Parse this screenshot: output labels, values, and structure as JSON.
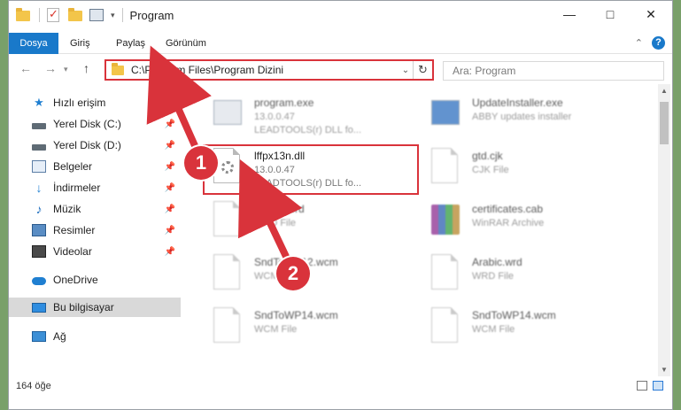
{
  "window": {
    "title": "Program",
    "icons": [
      "folder-icon",
      "check-icon",
      "properties-icon",
      "dropdown-icon"
    ]
  },
  "ribbon": {
    "tabs": [
      "Dosya",
      "Giriş",
      "Paylaş",
      "Görünüm"
    ],
    "accent_color": "#1979ca"
  },
  "address": {
    "path": "C:\\Program Files\\Program Dizini",
    "search_placeholder": "Ara: Program"
  },
  "nav": {
    "items": [
      {
        "label": "Hızlı erişim",
        "icon": "star-icon"
      },
      {
        "label": "Yerel Disk (C:)",
        "icon": "drive-icon",
        "pinned": true
      },
      {
        "label": "Yerel Disk (D:)",
        "icon": "drive-icon",
        "pinned": true
      },
      {
        "label": "Belgeler",
        "icon": "documents-icon",
        "pinned": true
      },
      {
        "label": "İndirmeler",
        "icon": "download-icon",
        "pinned": true
      },
      {
        "label": "Müzik",
        "icon": "music-icon",
        "pinned": true
      },
      {
        "label": "Resimler",
        "icon": "pictures-icon",
        "pinned": true
      },
      {
        "label": "Videolar",
        "icon": "videos-icon",
        "pinned": true
      },
      {
        "label": "OneDrive",
        "icon": "onedrive-icon"
      },
      {
        "label": "Bu bilgisayar",
        "icon": "computer-icon",
        "selected": true
      },
      {
        "label": "Ağ",
        "icon": "network-icon"
      }
    ]
  },
  "files": [
    {
      "name": "program.exe",
      "line2": "13.0.0.47",
      "line3": "LEADTOOLS(r) DLL fo...",
      "icon": "exe-icon",
      "blurred": true
    },
    {
      "name": "UpdateInstaller.exe",
      "line2": "ABBY updates installer",
      "line3": "",
      "icon": "installer-icon",
      "blurred": true
    },
    {
      "name": "lffpx13n.dll",
      "line2": "13.0.0.47",
      "line3": "LEADTOOLS(r) DLL fo...",
      "icon": "dll-icon",
      "blurred": false
    },
    {
      "name": "gtd.cjk",
      "line2": "CJK File",
      "line3": "",
      "icon": "file-icon",
      "blurred": true
    },
    {
      "name": "Arabic.wrd",
      "line2": "WRD File",
      "line3": "",
      "icon": "file-icon",
      "blurred": true
    },
    {
      "name": "certificates.cab",
      "line2": "WinRAR Archive",
      "line3": "",
      "icon": "rar-icon",
      "blurred": true
    },
    {
      "name": "SndToWP12.wcm",
      "line2": "WCM File",
      "line3": "",
      "icon": "file-icon",
      "blurred": true
    },
    {
      "name": "Arabic.wrd",
      "line2": "WRD File",
      "line3": "",
      "icon": "file-icon",
      "blurred": true
    },
    {
      "name": "SndToWP14.wcm",
      "line2": "WCM File",
      "line3": "",
      "icon": "file-icon",
      "blurred": true
    },
    {
      "name": "SndToWP14.wcm",
      "line2": "WCM File",
      "line3": "",
      "icon": "file-icon",
      "blurred": true
    }
  ],
  "status": {
    "item_count": "164 öğe"
  },
  "annotations": {
    "marker1": "1",
    "marker2": "2",
    "color": "#d9333b"
  }
}
